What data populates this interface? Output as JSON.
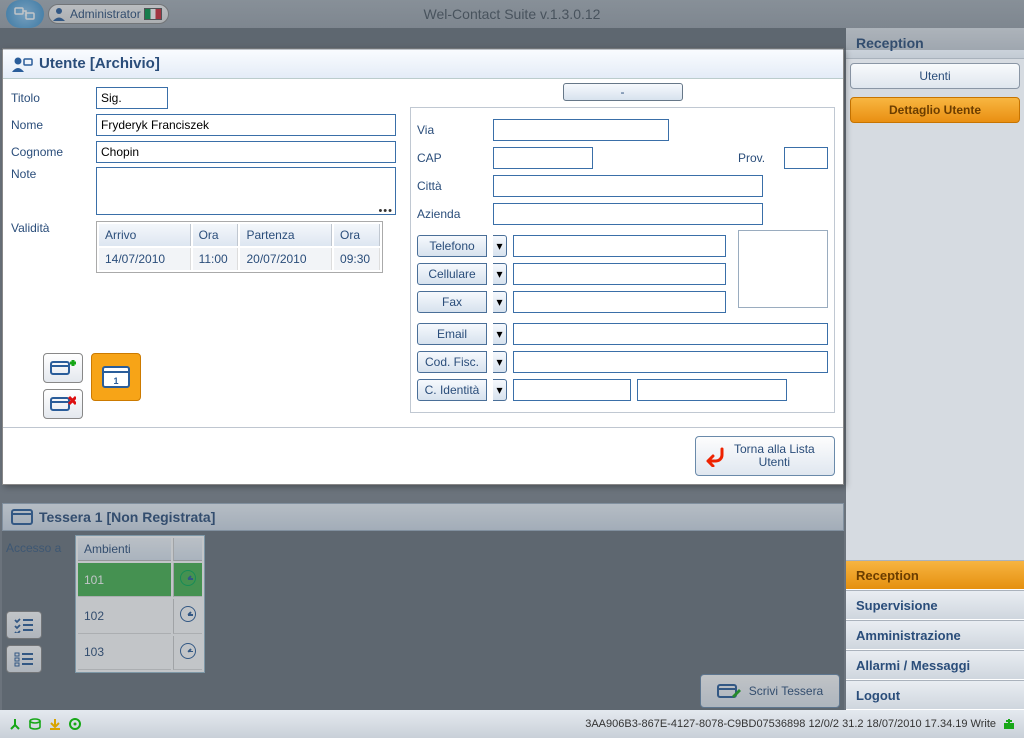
{
  "topbar": {
    "admin_label": "Administrator",
    "app_title": "Wel-Contact Suite v.1.3.0.12"
  },
  "panel": {
    "title": "Utente [Archivio]",
    "labels": {
      "titolo": "Titolo",
      "nome": "Nome",
      "cognome": "Cognome",
      "note": "Note",
      "validita": "Validità",
      "via": "Via",
      "cap": "CAP",
      "prov": "Prov.",
      "citta": "Città",
      "azienda": "Azienda",
      "telefono": "Telefono",
      "cellulare": "Cellulare",
      "fax": "Fax",
      "email": "Email",
      "codfisc": "Cod. Fisc.",
      "cidentita": "C. Identità"
    },
    "values": {
      "titolo": "Sig.",
      "nome": "Fryderyk Franciszek",
      "cognome": "Chopin",
      "note": "",
      "via": "",
      "cap": "",
      "prov": "",
      "citta": "",
      "azienda": ""
    },
    "dash_btn": "-",
    "validity_headers": {
      "arrivo": "Arrivo",
      "ora1": "Ora",
      "partenza": "Partenza",
      "ora2": "Ora"
    },
    "validity_row": {
      "arrivo": "14/07/2010",
      "ora1": "11:00",
      "partenza": "20/07/2010",
      "ora2": "09:30"
    },
    "card_number": "1",
    "back_btn_l1": "Torna alla Lista",
    "back_btn_l2": "Utenti"
  },
  "tessera": {
    "title": "Tessera 1 [Non Registrata]",
    "accesso": "Accesso a",
    "ambienti": "Ambienti",
    "rooms": [
      "101",
      "102",
      "103"
    ],
    "scrivi": "Scrivi Tessera"
  },
  "sidebar": {
    "title": "Reception",
    "utenti": "Utenti",
    "dettaglio": "Dettaglio Utente",
    "sections": {
      "reception": "Reception",
      "supervisione": "Supervisione",
      "amministrazione": "Amministrazione",
      "allarmi": "Allarmi / Messaggi",
      "logout": "Logout"
    }
  },
  "statusbar": {
    "text": "3AA906B3-867E-4127-8078-C9BD07536898 12/0/2 31.2 18/07/2010 17.34.19 Write"
  }
}
